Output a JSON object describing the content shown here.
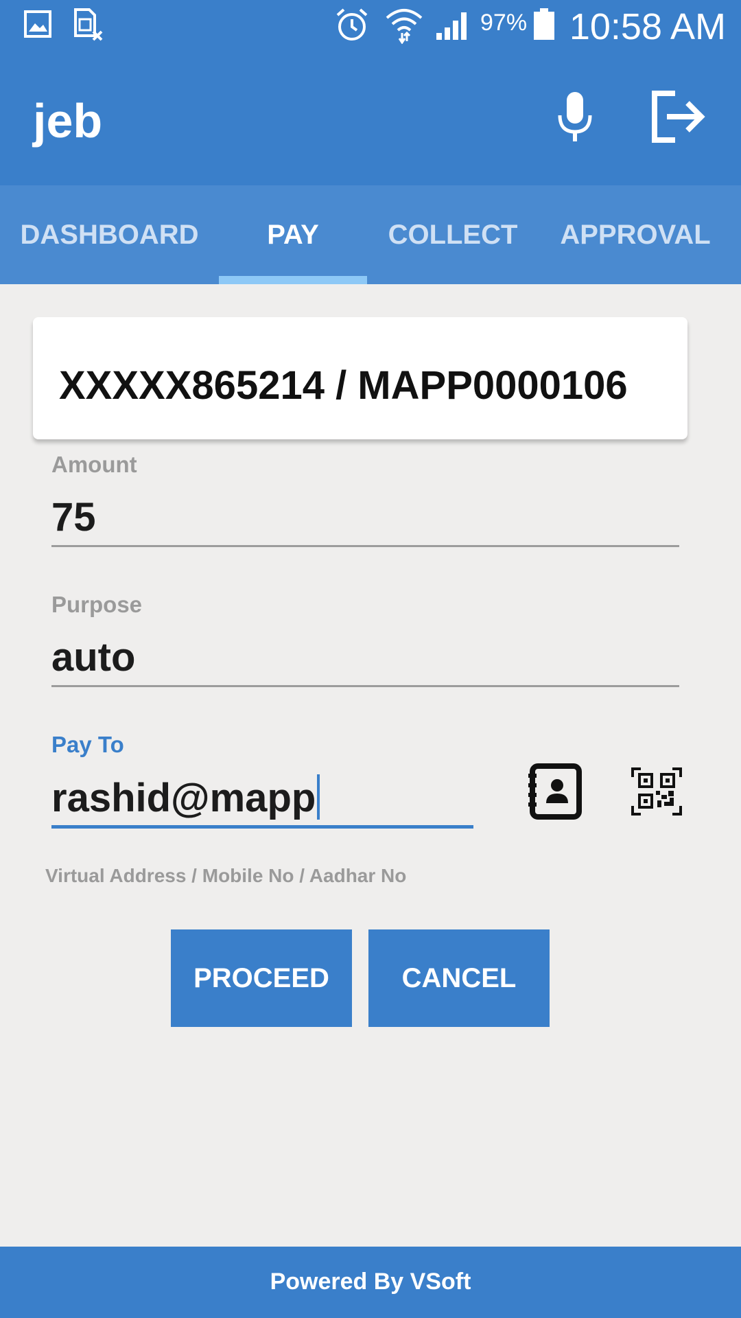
{
  "status_bar": {
    "battery_percent": "97%",
    "time": "10:58 AM",
    "icons": [
      "gallery-icon",
      "sim-card-icon",
      "alarm-icon",
      "wifi-icon",
      "signal-icon",
      "battery-icon"
    ]
  },
  "app_bar": {
    "title": "jeb",
    "icons": [
      "microphone-icon",
      "logout-icon"
    ]
  },
  "tabs": [
    {
      "label": "DASHBOARD",
      "active": false
    },
    {
      "label": "PAY",
      "active": true
    },
    {
      "label": "COLLECT",
      "active": false
    },
    {
      "label": "APPROVAL",
      "active": false
    }
  ],
  "account": {
    "text": "XXXXX865214 / MAPP0000106"
  },
  "form": {
    "amount": {
      "label": "Amount",
      "value": "75"
    },
    "purpose": {
      "label": "Purpose",
      "value": "auto"
    },
    "pay_to": {
      "label": "Pay To",
      "value": "rashid@mapp",
      "hint": "Virtual Address / Mobile No / Aadhar No",
      "icons": [
        "contacts-book-icon",
        "qr-code-scan-icon"
      ]
    }
  },
  "buttons": {
    "proceed": "PROCEED",
    "cancel": "CANCEL"
  },
  "footer": {
    "text": "Powered By VSoft"
  },
  "colors": {
    "primary": "#3a7fca",
    "tab_bar": "#4a8ad0",
    "tab_indicator": "#8dc8f6",
    "background": "#efeeed"
  }
}
